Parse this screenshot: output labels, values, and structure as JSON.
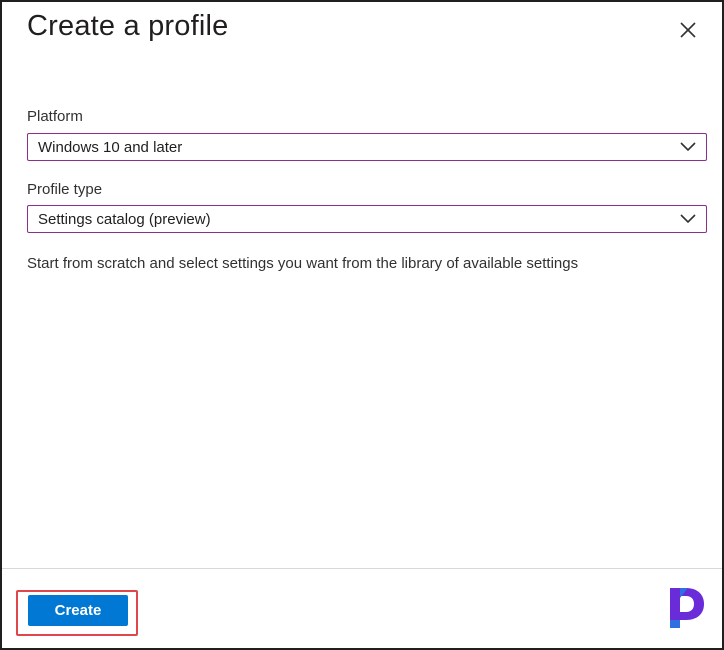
{
  "dialog": {
    "title": "Create a profile",
    "close_icon": "close-icon"
  },
  "platform": {
    "label": "Platform",
    "value": "Windows 10 and later",
    "icon": "chevron-down-icon"
  },
  "profile_type": {
    "label": "Profile type",
    "value": "Settings catalog (preview)",
    "icon": "chevron-down-icon"
  },
  "description": "Start from scratch and select settings you want from the library of available settings",
  "footer": {
    "create_label": "Create",
    "logo_icon": "brand-logo-icon"
  },
  "colors": {
    "primary_button": "#0078d4",
    "select_border": "#8a2f8a",
    "highlight": "#e0474c",
    "logo_purple": "#6a2bd9",
    "logo_blue": "#2f6fe0"
  }
}
